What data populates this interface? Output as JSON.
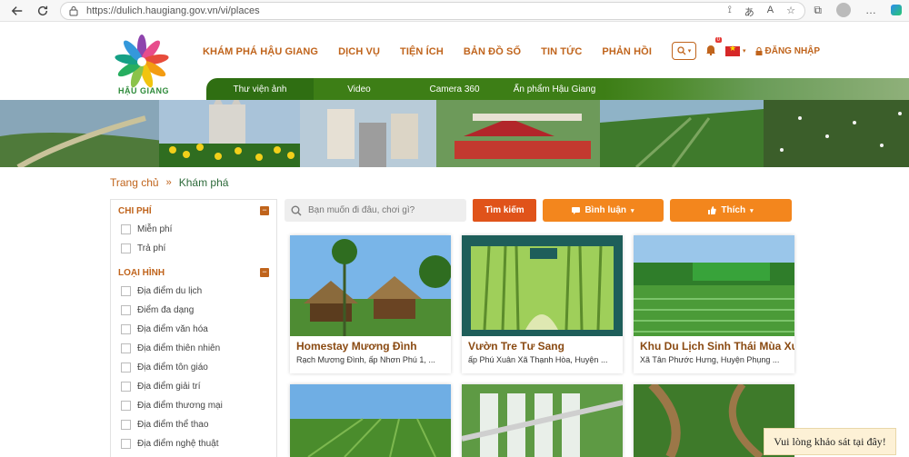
{
  "browser": {
    "url": "https://dulich.haugiang.gov.vn/vi/places"
  },
  "header": {
    "logo_text": "HẬU GIANG",
    "nav": [
      {
        "label": "KHÁM PHÁ HẬU GIANG"
      },
      {
        "label": "DỊCH VỤ"
      },
      {
        "label": "TIỆN ÍCH"
      },
      {
        "label": "BẢN ĐỒ SỐ"
      },
      {
        "label": "TIN TỨC"
      },
      {
        "label": "PHẢN HỒI"
      }
    ],
    "notification_count": "0",
    "login_label": "ĐĂNG NHẬP",
    "subnav": [
      {
        "label": "Thư viện ảnh"
      },
      {
        "label": "Video"
      },
      {
        "label": "Camera 360"
      },
      {
        "label": "Ấn phẩm Hậu Giang"
      }
    ]
  },
  "breadcrumb": {
    "home": "Trang chủ",
    "separator": "»",
    "current": "Khám phá"
  },
  "sidebar": {
    "cost": {
      "title": "CHI PHÍ",
      "options": [
        {
          "label": "Miễn phí"
        },
        {
          "label": "Trả phí"
        }
      ]
    },
    "type": {
      "title": "LOẠI HÌNH",
      "options": [
        {
          "label": "Địa điểm du lịch"
        },
        {
          "label": "Điểm đa dạng"
        },
        {
          "label": "Địa điểm văn hóa"
        },
        {
          "label": "Địa điểm thiên nhiên"
        },
        {
          "label": "Địa điểm tôn giáo"
        },
        {
          "label": "Địa điểm giải trí"
        },
        {
          "label": "Địa điểm thương mại"
        },
        {
          "label": "Địa điểm thể thao"
        },
        {
          "label": "Địa điểm nghệ thuật"
        }
      ]
    }
  },
  "search": {
    "placeholder": "Bạn muốn đi đâu, chơi gì?",
    "button": "Tìm kiếm",
    "sort_comment": "Bình luận",
    "sort_like": "Thích"
  },
  "cards": [
    {
      "title": "Homestay Mương Đình",
      "address": "Rạch Mương Đình, ấp Nhơn Phú 1, ..."
    },
    {
      "title": "Vườn Tre Tư Sang",
      "address": "ấp Phú Xuân Xã Thạnh Hòa, Huyện ..."
    },
    {
      "title": "Khu Du Lịch Sinh Thái Mùa Xuân",
      "address": "Xã Tân Phước Hưng, Huyện Phụng ..."
    }
  ],
  "survey_label": "Vui lòng khảo sát tại đây!"
}
